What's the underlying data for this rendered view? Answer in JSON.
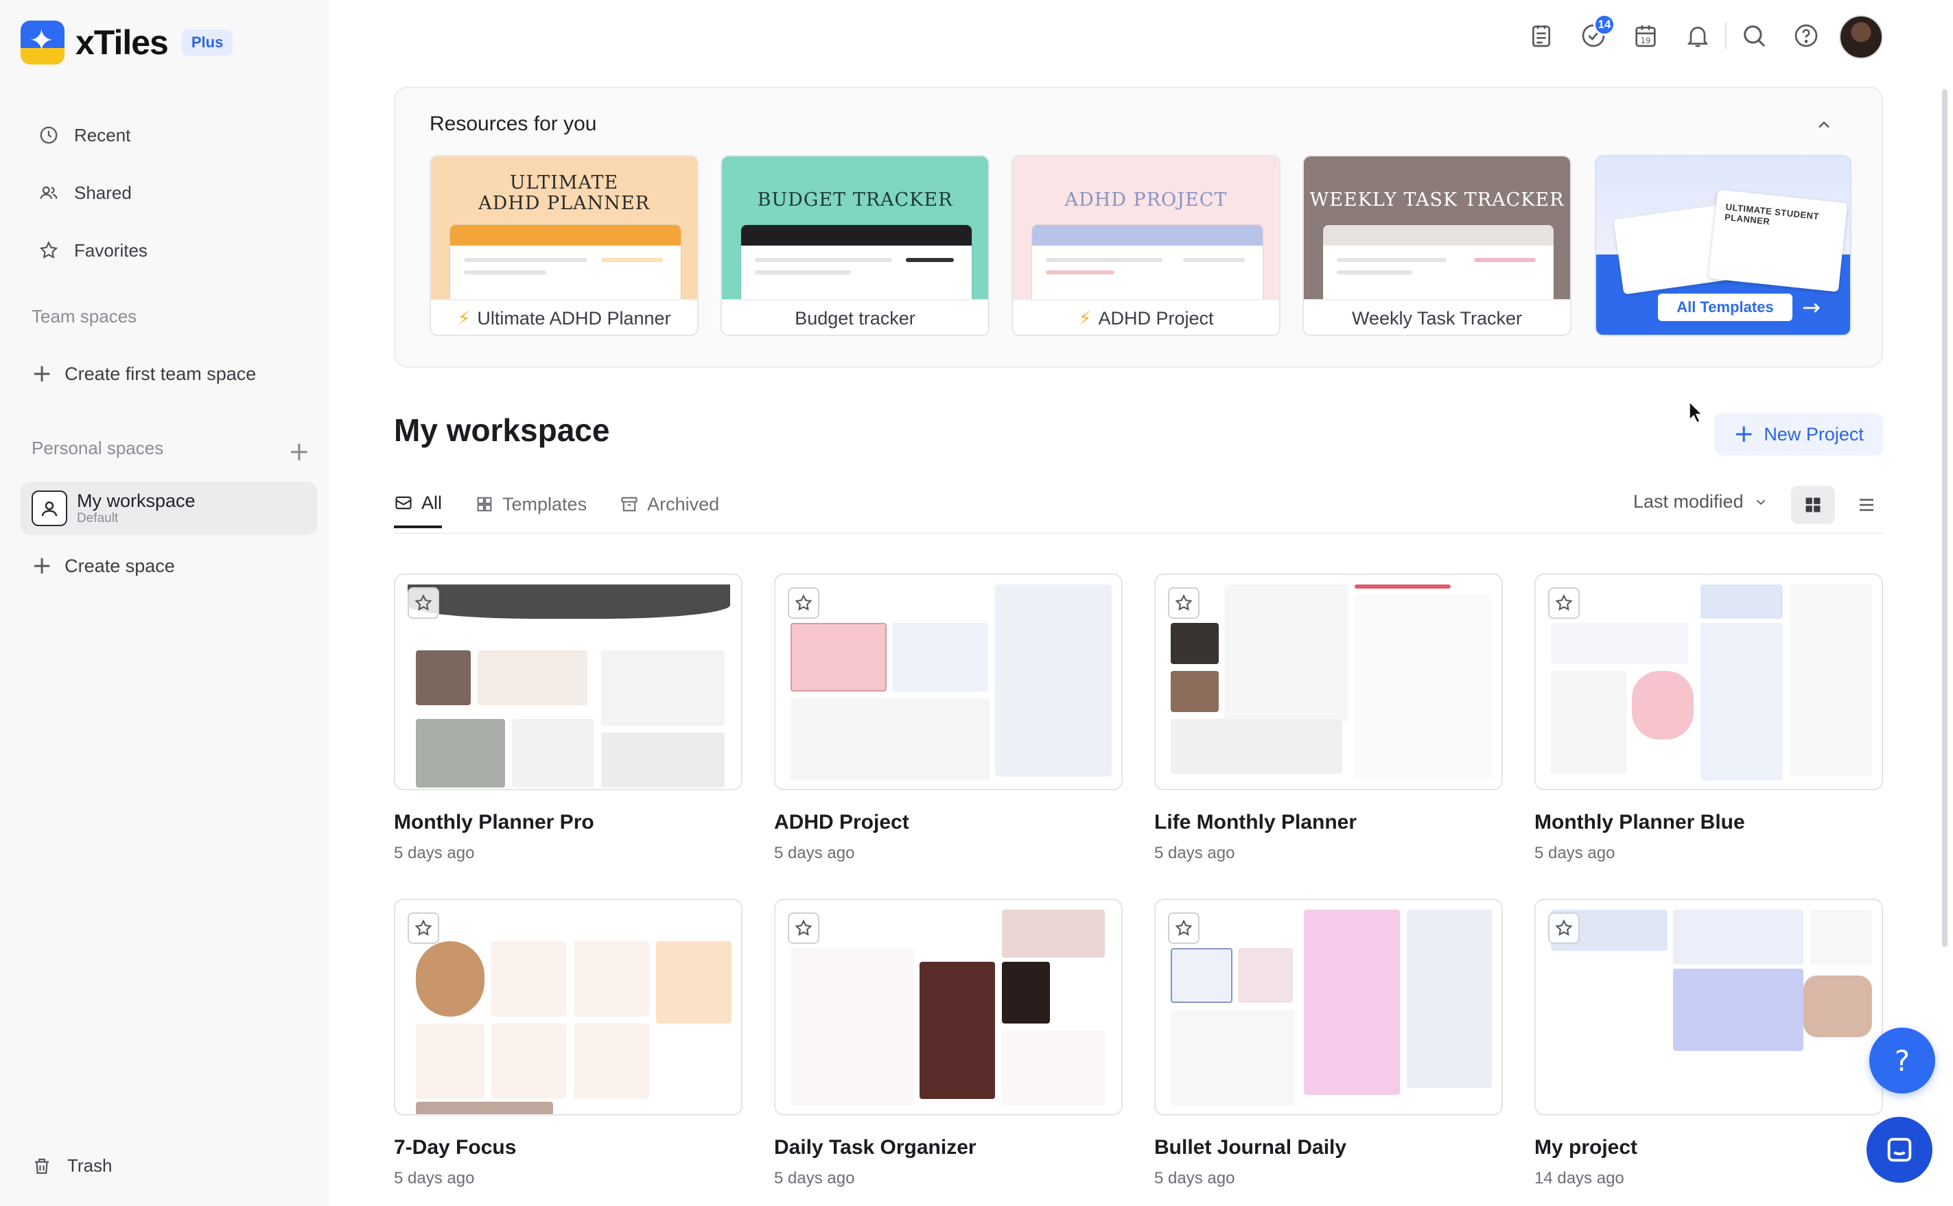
{
  "app": {
    "name": "xTiles",
    "plan": "Plus"
  },
  "header": {
    "notification_count": "14"
  },
  "sidebar": {
    "nav": [
      {
        "label": "Recent",
        "icon": "clock-icon"
      },
      {
        "label": "Shared",
        "icon": "users-icon"
      },
      {
        "label": "Favorites",
        "icon": "star-icon"
      }
    ],
    "team_spaces_label": "Team spaces",
    "create_team_space": "Create first team space",
    "personal_spaces_label": "Personal spaces",
    "space": {
      "name": "My workspace",
      "sub": "Default"
    },
    "create_space": "Create space",
    "trash": "Trash"
  },
  "resources": {
    "title": "Resources for you",
    "cards": [
      {
        "thumb_title_line1": "ULTIMATE",
        "thumb_title_line2": "ADHD PLANNER",
        "label": "Ultimate ADHD Planner",
        "bolt": true,
        "bg": "#fbd9b0",
        "bar": "#f4a53a"
      },
      {
        "thumb_title_line1": "BUDGET TRACKER",
        "label": "Budget tracker",
        "bolt": false,
        "bg": "#7fd6c1",
        "bar": "#1f1f22"
      },
      {
        "thumb_title_line1": "ADHD PROJECT",
        "label": "ADHD Project",
        "bolt": true,
        "bg": "#fbe4e6",
        "bar": "#b8c3ea"
      },
      {
        "thumb_title_line1": "WEEKLY TASK TRACKER",
        "label": "Weekly Task Tracker",
        "bolt": false,
        "bg": "#8c7c79",
        "bar": "#e8e2de"
      }
    ],
    "all_templates": {
      "label": "All Templates",
      "paper_title": "ULTIMATE STUDENT PLANNER"
    }
  },
  "workspace": {
    "title": "My workspace",
    "new_project": "New Project",
    "tabs": [
      {
        "label": "All",
        "active": true
      },
      {
        "label": "Templates",
        "active": false
      },
      {
        "label": "Archived",
        "active": false
      }
    ],
    "sort_label": "Last modified",
    "projects": [
      {
        "name": "Monthly Planner Pro",
        "date": "5 days ago"
      },
      {
        "name": "ADHD Project",
        "date": "5 days ago"
      },
      {
        "name": "Life Monthly Planner",
        "date": "5 days ago"
      },
      {
        "name": "Monthly Planner Blue",
        "date": "5 days ago"
      },
      {
        "name": "7-Day Focus",
        "date": "5 days ago"
      },
      {
        "name": "Daily Task Organizer",
        "date": "5 days ago"
      },
      {
        "name": "Bullet Journal Daily",
        "date": "5 days ago"
      },
      {
        "name": "My project",
        "date": "14 days ago"
      }
    ]
  },
  "help_fab": "?"
}
